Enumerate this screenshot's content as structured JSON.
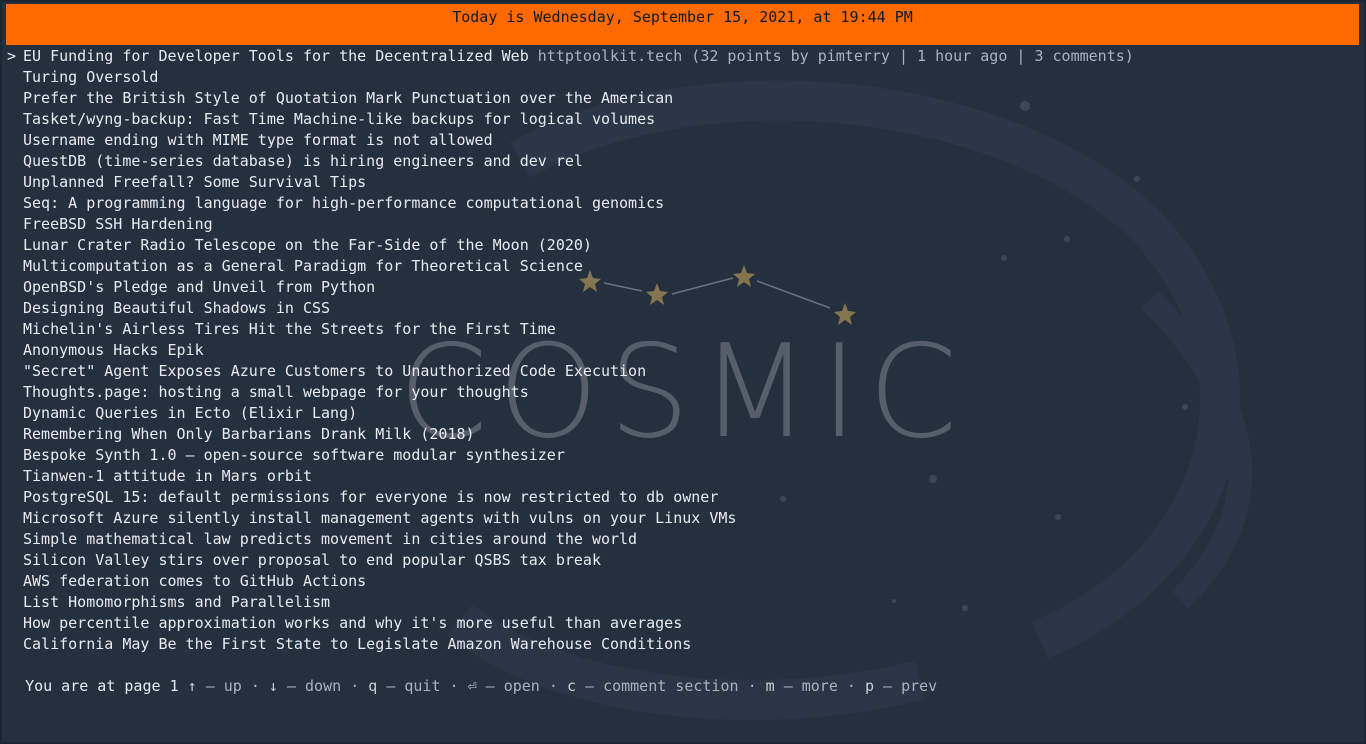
{
  "header": {
    "date_text": "Today is Wednesday, September 15, 2021, at 19:44 PM",
    "accent_color": "#ff6a00"
  },
  "wallpaper": {
    "text": "COSMIC"
  },
  "selected_marker": ">",
  "stories": [
    {
      "title": "EU Funding for Developer Tools for the Decentralized Web",
      "meta": "httptoolkit.tech (32 points by pimterry | 1 hour ago | 3 comments)"
    },
    {
      "title": "Turing Oversold"
    },
    {
      "title": "Prefer the British Style of Quotation Mark Punctuation over the American"
    },
    {
      "title": "Tasket/wyng-backup: Fast Time Machine-like backups for logical volumes"
    },
    {
      "title": "Username ending with MIME type format is not allowed"
    },
    {
      "title": "QuestDB (time-series database) is hiring engineers and dev rel"
    },
    {
      "title": "Unplanned Freefall? Some Survival Tips"
    },
    {
      "title": "Seq: A programming language for high-performance computational genomics"
    },
    {
      "title": "FreeBSD SSH Hardening"
    },
    {
      "title": "Lunar Crater Radio Telescope on the Far-Side of the Moon (2020)"
    },
    {
      "title": "Multicomputation as a General Paradigm for Theoretical Science"
    },
    {
      "title": "OpenBSD's Pledge and Unveil from Python"
    },
    {
      "title": "Designing Beautiful Shadows in CSS"
    },
    {
      "title": "Michelin's Airless Tires Hit the Streets for the First Time"
    },
    {
      "title": "Anonymous Hacks Epik"
    },
    {
      "title": "\"Secret\" Agent Exposes Azure Customers to Unauthorized Code Execution"
    },
    {
      "title": "Thoughts.page: hosting a small webpage for your thoughts"
    },
    {
      "title": "Dynamic Queries in Ecto (Elixir Lang)"
    },
    {
      "title": "Remembering When Only Barbarians Drank Milk (2018)"
    },
    {
      "title": "Bespoke Synth 1.0 – open-source software modular synthesizer"
    },
    {
      "title": "Tianwen-1 attitude in Mars orbit"
    },
    {
      "title": "PostgreSQL 15: default permissions for everyone is now restricted to db owner"
    },
    {
      "title": "Microsoft Azure silently install management agents with vulns on your Linux VMs"
    },
    {
      "title": "Simple mathematical law predicts movement in cities around the world"
    },
    {
      "title": "Silicon Valley stirs over proposal to end popular QSBS tax break"
    },
    {
      "title": "AWS federation comes to GitHub Actions"
    },
    {
      "title": "List Homomorphisms and Parallelism"
    },
    {
      "title": "How percentile approximation works and why it's more useful than averages"
    },
    {
      "title": "California May Be the First State to Legislate Amazon Warehouse Conditions"
    }
  ],
  "footer": {
    "page_prefix": "You are at page",
    "page_number": "1",
    "keys": [
      {
        "key": "↑",
        "action": "up"
      },
      {
        "key": "↓",
        "action": "down"
      },
      {
        "key": "q",
        "action": "quit"
      },
      {
        "key": "⏎",
        "action": "open"
      },
      {
        "key": "c",
        "action": "comment section"
      },
      {
        "key": "m",
        "action": "more"
      },
      {
        "key": "p",
        "action": "prev"
      }
    ],
    "separator": "·",
    "dash": "–"
  }
}
